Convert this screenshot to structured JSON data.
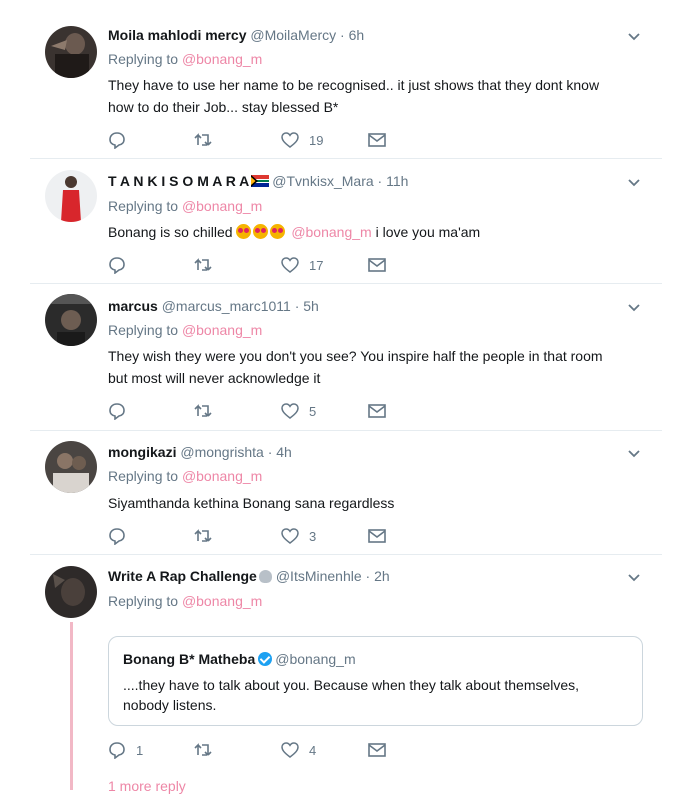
{
  "tweets": [
    {
      "name": "Moila mahlodi mercy",
      "handle": "@MoilaMercy",
      "time": "· 6h",
      "replying_prefix": "Replying to ",
      "replying_to": "@bonang_m",
      "text_lines": [
        "They have to use her name to be recognised.. it just shows that they dont know",
        "how to do their Job... stay blessed B*"
      ],
      "likes": "19"
    },
    {
      "name": "T A N K I S O M A R A",
      "handle": "@Tvnkisx_Mara",
      "time": "· 11h",
      "replying_prefix": "Replying to ",
      "replying_to": "@bonang_m",
      "text_before": "Bonang is so chilled",
      "text_mention": "@bonang_m",
      "text_after": " i love you ma'am",
      "likes": "17"
    },
    {
      "name": "marcus",
      "handle": "@marcus_marc1011",
      "time": "· 5h",
      "replying_prefix": "Replying to ",
      "replying_to": "@bonang_m",
      "text_lines": [
        "They wish they were you don't you see? You inspire half the people in that room",
        "but most will never acknowledge it"
      ],
      "likes": "5"
    },
    {
      "name": "mongikazi",
      "handle": "@mongrishta",
      "time": "· 4h",
      "replying_prefix": "Replying to ",
      "replying_to": "@bonang_m",
      "text_lines": [
        "Siyamthanda kethina Bonang sana regardless"
      ],
      "likes": "3"
    },
    {
      "name": "Write A Rap Challenge",
      "handle": "@ItsMinenhle",
      "time": "· 2h",
      "replying_prefix": "Replying to ",
      "replying_to": "@bonang_m",
      "quote": {
        "name": "Bonang B* Matheba",
        "handle": "@bonang_m",
        "text_lines": [
          "....they have to talk about you. Because when they talk about themselves,",
          "nobody listens."
        ]
      },
      "replies": "1",
      "likes": "4"
    }
  ],
  "more_replies": "1 more reply",
  "icons": {
    "reply": "reply-icon",
    "retweet": "retweet-icon",
    "like": "heart-icon",
    "dm": "envelope-icon",
    "menu": "chevron-down-icon"
  },
  "colors": {
    "accent": "#e0245e",
    "muted": "#657786",
    "divider": "#e6ecf0"
  }
}
